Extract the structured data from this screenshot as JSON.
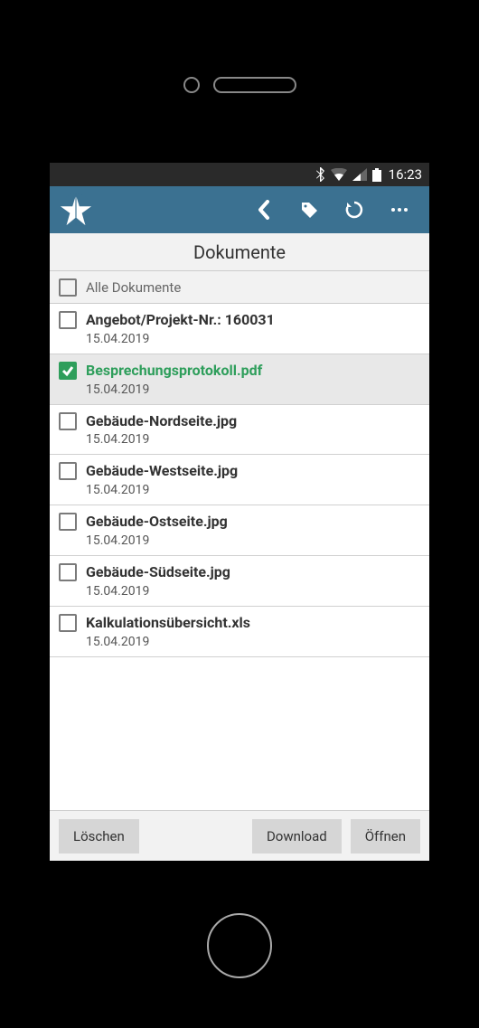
{
  "status": {
    "time": "16:23"
  },
  "header": {
    "title": "Dokumente"
  },
  "select_all": {
    "label": "Alle Dokumente",
    "checked": false
  },
  "documents": [
    {
      "title": "Angebot/Projekt-Nr.: 160031",
      "date": "15.04.2019",
      "checked": false
    },
    {
      "title": "Besprechungsprotokoll.pdf",
      "date": "15.04.2019",
      "checked": true
    },
    {
      "title": "Gebäude-Nordseite.jpg",
      "date": "15.04.2019",
      "checked": false
    },
    {
      "title": "Gebäude-Westseite.jpg",
      "date": "15.04.2019",
      "checked": false
    },
    {
      "title": "Gebäude-Ostseite.jpg",
      "date": "15.04.2019",
      "checked": false
    },
    {
      "title": "Gebäude-Südseite.jpg",
      "date": "15.04.2019",
      "checked": false
    },
    {
      "title": "Kalkulationsübersicht.xls",
      "date": "15.04.2019",
      "checked": false
    }
  ],
  "buttons": {
    "delete": "Löschen",
    "download": "Download",
    "open": "Öffnen"
  }
}
